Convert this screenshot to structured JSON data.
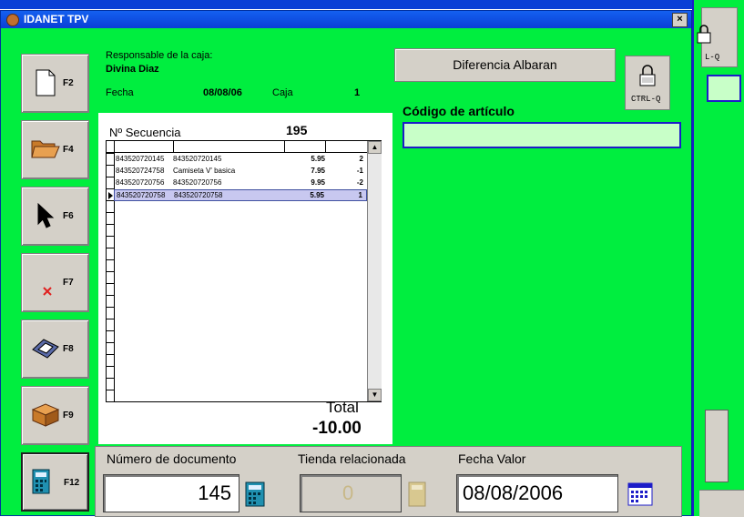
{
  "background_window": {
    "ctrl_label": "L-Q"
  },
  "window": {
    "title": "IDANET TPV",
    "close": "×"
  },
  "fkeys": [
    {
      "key": "F2",
      "icon": "new-document-icon"
    },
    {
      "key": "F4",
      "icon": "open-folder-icon"
    },
    {
      "key": "F6",
      "icon": "pointer-icon"
    },
    {
      "key": "F7",
      "icon": "delete-x-icon"
    },
    {
      "key": "F8",
      "icon": "disk-icon"
    },
    {
      "key": "F9",
      "icon": "box-icon"
    },
    {
      "key": "F12",
      "icon": "calculator-icon"
    }
  ],
  "info": {
    "responsable_label": "Responsable de la caja:",
    "responsable_name": "Divina Diaz",
    "fecha_label": "Fecha",
    "fecha_value": "08/08/06",
    "caja_label": "Caja",
    "caja_value": "1"
  },
  "sequence": {
    "label": "Nº Secuencia",
    "value": "195"
  },
  "rows": [
    {
      "ean": "843520720145",
      "desc": "843520720145",
      "price": "5.95",
      "qty": "2"
    },
    {
      "ean": "843520724758",
      "desc": "Camiseta V' basica",
      "price": "7.95",
      "qty": "-1"
    },
    {
      "ean": "843520720756",
      "desc": "843520720756",
      "price": "9.95",
      "qty": "-2"
    },
    {
      "ean": "843520720758",
      "desc": "843520720758",
      "price": "5.95",
      "qty": "1"
    }
  ],
  "total": {
    "label": "Total",
    "value": "-10.00"
  },
  "buttons": {
    "diferencia": "Diferencia Albaran",
    "ctrlq": "CTRL-Q"
  },
  "codigo": {
    "label": "Código de artículo",
    "value": ""
  },
  "bottom": {
    "numero_label": "Número de documento",
    "numero_value": "145",
    "tienda_label": "Tienda relacionada",
    "tienda_value": "0",
    "fecha_valor_label": "Fecha Valor",
    "fecha_valor_value": "08/08/2006"
  },
  "colors": {
    "panel_green": "#00ee3f",
    "title_blue": "#0a3fd6",
    "input_green": "#c8ffc8",
    "input_border": "#1c1cc8",
    "selected_row": "#c8c8f0"
  }
}
